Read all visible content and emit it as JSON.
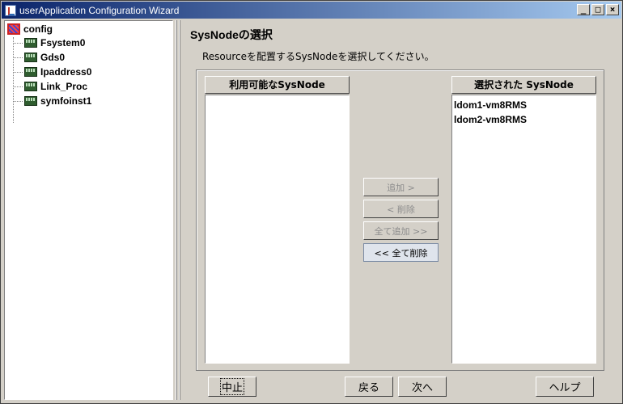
{
  "window": {
    "title": "userApplication Configuration Wizard",
    "controls": {
      "minimize": "_",
      "maximize": "□",
      "close": "×"
    }
  },
  "tree": {
    "root": {
      "label": "config",
      "icon": "config-icon"
    },
    "items": [
      {
        "label": "Fsystem0",
        "icon": "resource-icon"
      },
      {
        "label": "Gds0",
        "icon": "resource-icon"
      },
      {
        "label": "Ipaddress0",
        "icon": "resource-icon"
      },
      {
        "label": "Link_Proc",
        "icon": "resource-icon"
      },
      {
        "label": "symfoinst1",
        "icon": "resource-icon"
      }
    ]
  },
  "main": {
    "heading": "SysNodeの選択",
    "description": "Resourceを配置するSysNodeを選択してください。",
    "available": {
      "header": "利用可能なSysNode",
      "items": []
    },
    "selected": {
      "header": "選択された SysNode",
      "items": [
        "ldom1-vm8RMS",
        "ldom2-vm8RMS"
      ]
    },
    "transfer": {
      "add": "追加 >",
      "remove": "< 削除",
      "add_all": "全て追加 >>",
      "remove_all": "<< 全て削除"
    }
  },
  "footer": {
    "cancel": "中止",
    "back": "戻る",
    "next": "次へ",
    "help": "ヘルプ"
  }
}
